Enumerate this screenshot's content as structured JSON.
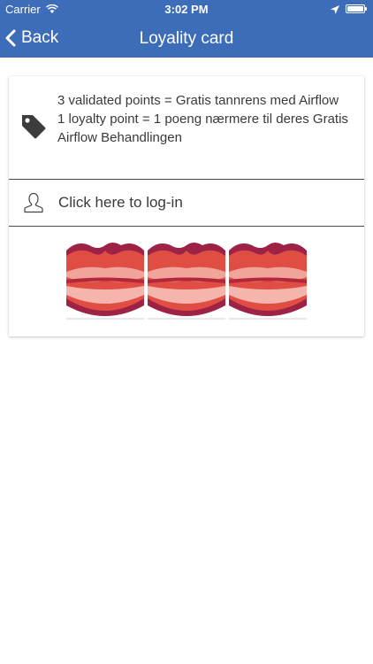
{
  "status_bar": {
    "carrier": "Carrier",
    "time": "3:02 PM",
    "wifi_icon": "wifi-icon",
    "location_icon": "location-arrow-icon",
    "battery_level": 1.0
  },
  "nav": {
    "back_label": "Back",
    "title": "Loyality card",
    "background_color": "#3d6cb8"
  },
  "card": {
    "info_lines": [
      "3 validated points = Gratis tannrens med Airflow",
      "1 loyalty point = 1 poeng nærmere til deres Gratis Airflow Behandlingen"
    ],
    "info_icon": "tag-icon",
    "login_label": "Click here to log-in",
    "login_icon": "user-icon",
    "stamps": [
      {
        "icon": "lips-stamp-icon"
      },
      {
        "icon": "lips-stamp-icon"
      },
      {
        "icon": "lips-stamp-icon"
      }
    ]
  }
}
